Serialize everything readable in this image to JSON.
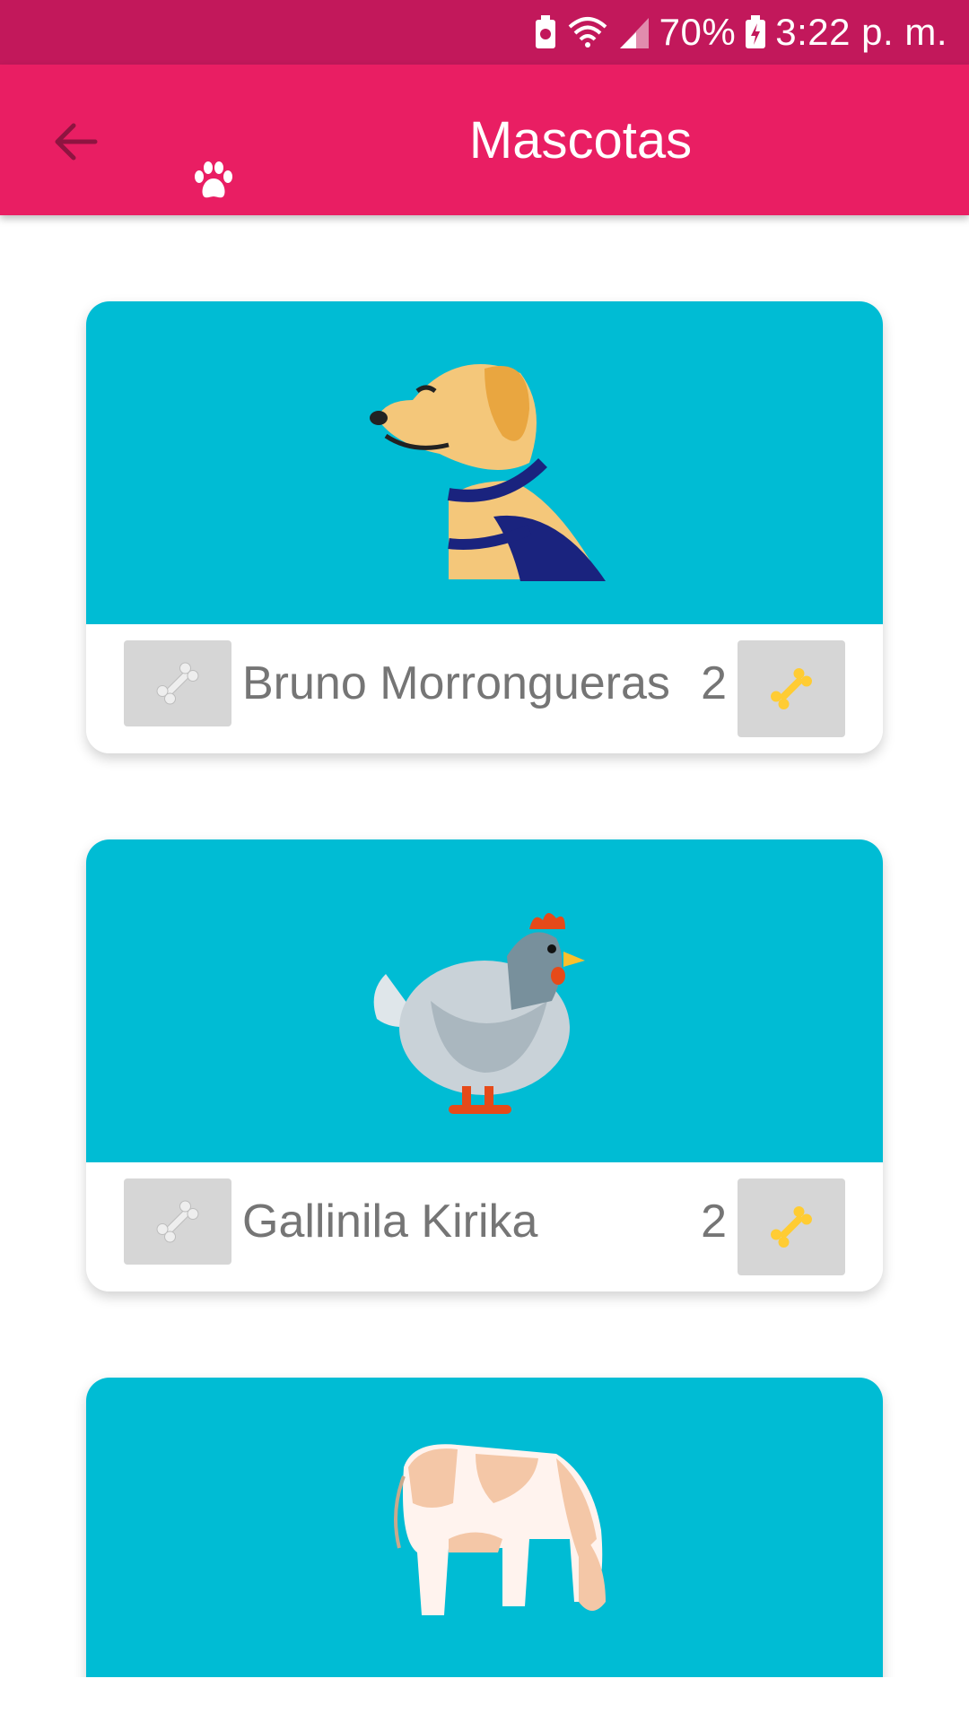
{
  "status_bar": {
    "battery_percent": "70%",
    "time": "3:22 p. m."
  },
  "app_bar": {
    "title": "Mascotas",
    "back_icon": "arrow-back-icon",
    "logo_icon": "paw-icon"
  },
  "pets": [
    {
      "name": "Bruno Morrongueras",
      "likes": "2",
      "image": "dog-icon"
    },
    {
      "name": "Gallinila Kirika",
      "likes": "2",
      "image": "chicken-icon"
    },
    {
      "name": "",
      "likes": "",
      "image": "cow-icon"
    }
  ],
  "colors": {
    "status_bar": "#c2185b",
    "app_bar": "#e91e63",
    "card_image_bg": "#00bcd4",
    "button_bg": "#d6d6d6",
    "bone_gray": "#e6e6e6",
    "bone_gold": "#ffcc33"
  }
}
